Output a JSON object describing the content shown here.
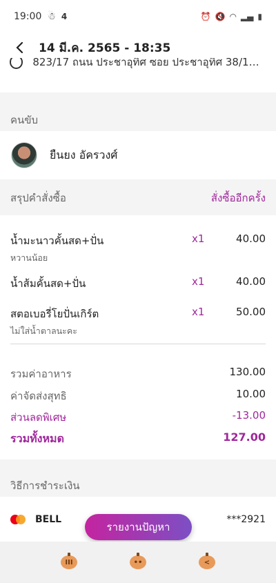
{
  "status_bar": {
    "time": "19:00",
    "extra": "4"
  },
  "header": {
    "title": "14 มี.ค. 2565 - 18:35"
  },
  "address": {
    "text": "823/17 ถนน ประชาอุทิศ ซอย ประชาอุทิศ 38/1, อ..."
  },
  "driver_section": {
    "label": "คนขับ",
    "name": "ยืนยง อัครวงศ์"
  },
  "order_summary": {
    "label": "สรุปคำสั่งซื้อ",
    "reorder_label": "สั่งซื้ออีกครั้ง",
    "items": [
      {
        "name": "น้ำมะนาวคั้นสด+ปั่น",
        "note": "หวานน้อย",
        "qty": "x1",
        "price": "40.00"
      },
      {
        "name": "น้ำส้มคั้นสด+ปั่น",
        "note": "",
        "qty": "x1",
        "price": "40.00"
      },
      {
        "name": "สตอเบอรี่โยปั่นเกิร์ต",
        "note": "ไม่ใส่น้ำตาลนะคะ",
        "qty": "x1",
        "price": "50.00"
      }
    ],
    "totals": {
      "food_label": "รวมค่าอาหาร",
      "food_value": "130.00",
      "delivery_label": "ค่าจัดส่งสุทธิ",
      "delivery_value": "10.00",
      "discount_label": "ส่วนลดพิเศษ",
      "discount_value": "-13.00",
      "grand_label": "รวมทั้งหมด",
      "grand_value": "127.00"
    }
  },
  "payment": {
    "label": "วิธีการชำระเงิน",
    "name": "BELL",
    "card_number": "***2921"
  },
  "report_button": {
    "label": "รายงานปัญหา"
  },
  "nav": {
    "icons": [
      "recent-apps-icon",
      "home-icon",
      "back-icon"
    ]
  },
  "colors": {
    "accent": "#a0279c",
    "button_start": "#c4249f",
    "button_end": "#7d4fc4"
  }
}
